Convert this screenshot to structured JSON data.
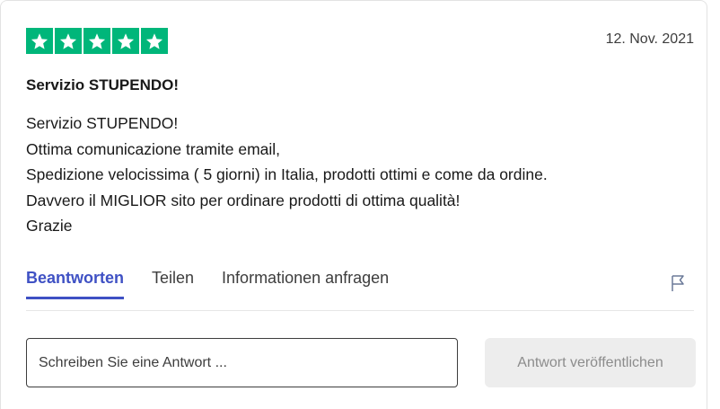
{
  "review": {
    "rating": 5,
    "rating_max": 5,
    "star_color": "#00b67a",
    "date": "12. Nov. 2021",
    "title": "Servizio STUPENDO!",
    "body_lines": [
      "Servizio STUPENDO!",
      "Ottima comunicazione tramite email,",
      "Spedizione velocissima ( 5 giorni) in Italia, prodotti ottimi e come da ordine.",
      "Davvero il MIGLIOR sito per ordinare prodotti di ottima qualità!",
      "Grazie"
    ]
  },
  "tabs": [
    {
      "label": "Beantworten",
      "active": true
    },
    {
      "label": "Teilen",
      "active": false
    },
    {
      "label": "Informationen anfragen",
      "active": false
    }
  ],
  "accent_color": "#3f51c4",
  "flag_icon": "flag-icon",
  "reply": {
    "placeholder": "Schreiben Sie eine Antwort ...",
    "value": "",
    "publish_label": "Antwort veröffentlichen",
    "publish_enabled": false
  }
}
